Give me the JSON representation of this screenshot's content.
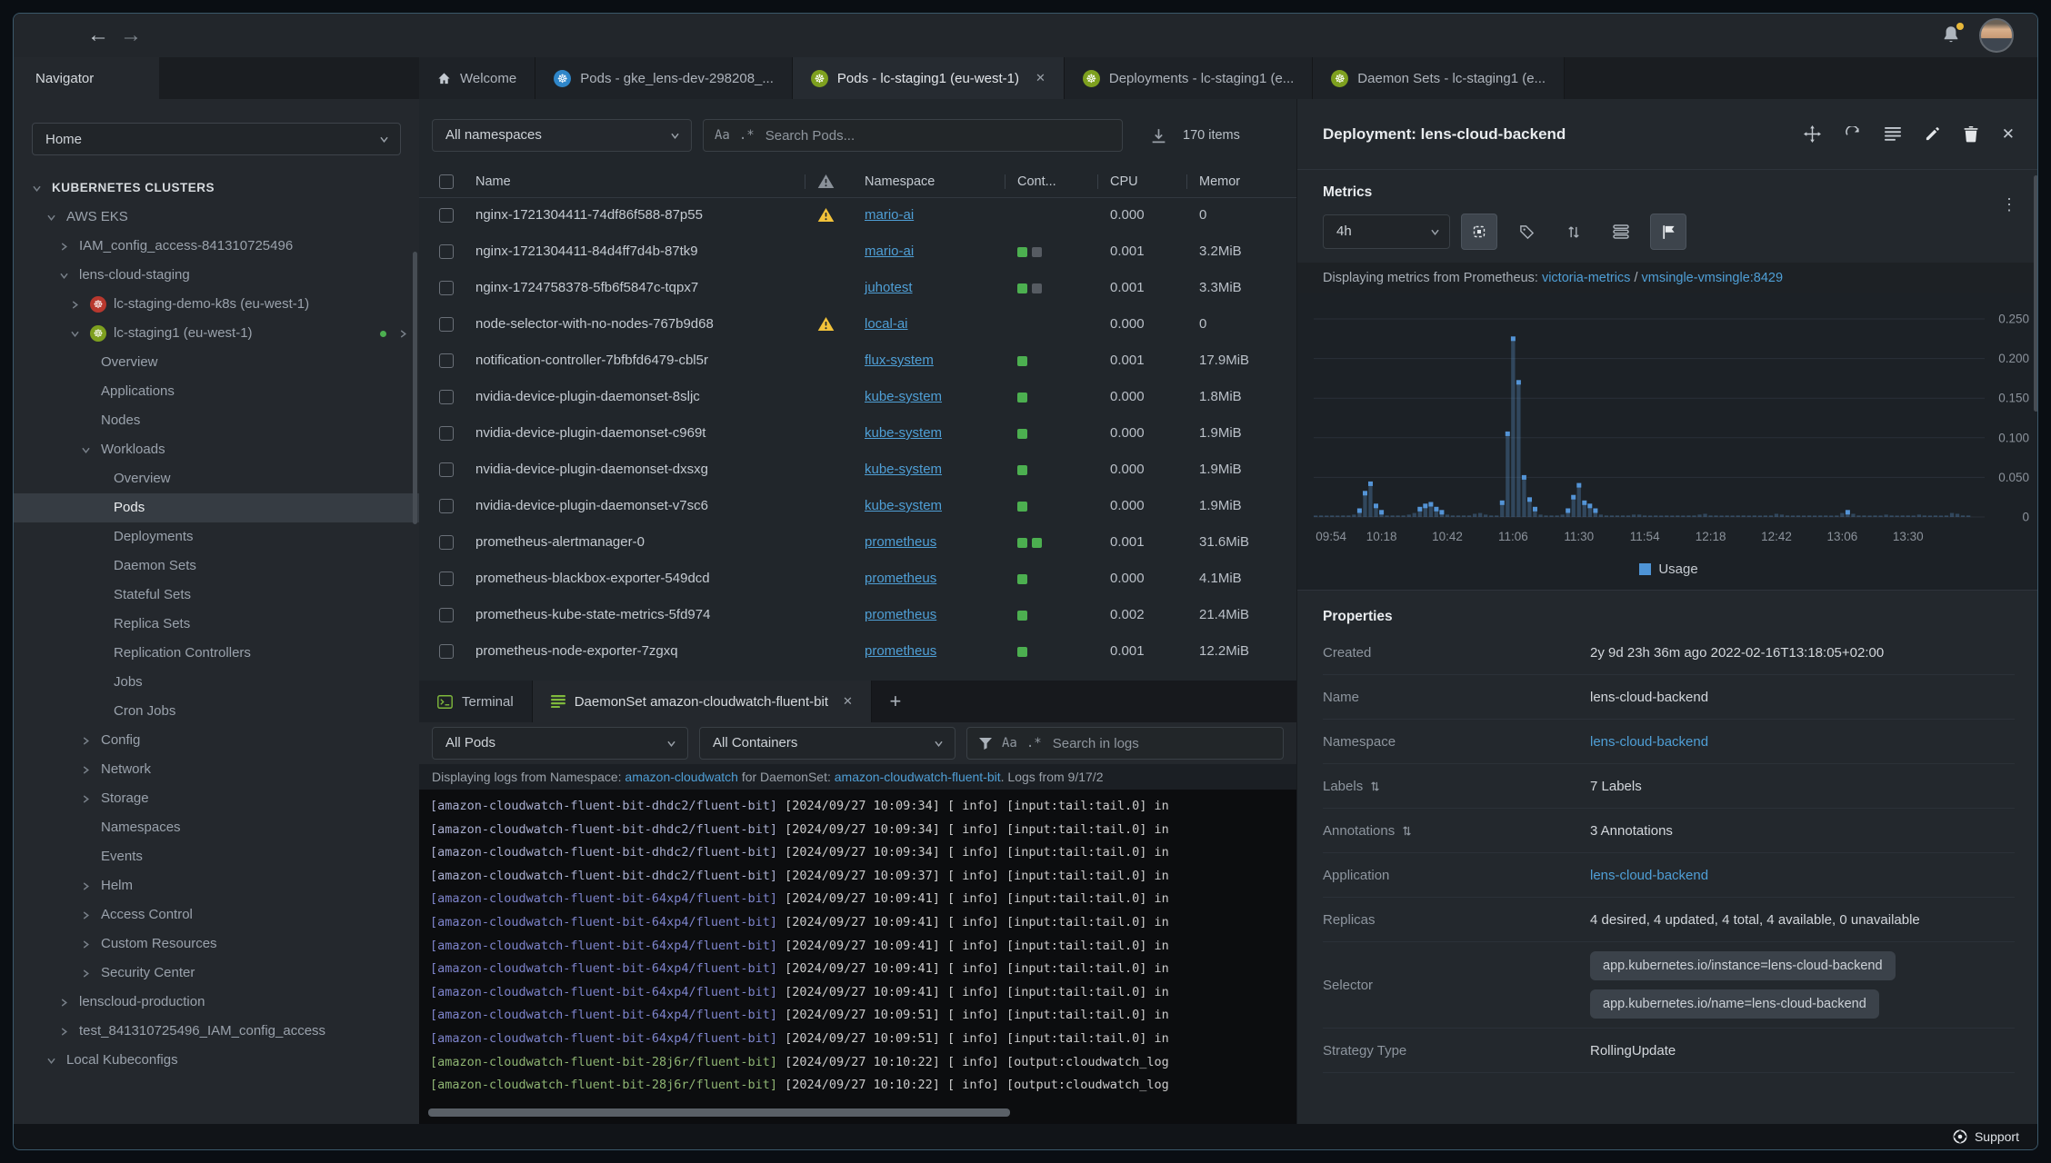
{
  "topbar": {
    "back": "←",
    "forward": "→"
  },
  "tabs": {
    "navigator": "Navigator",
    "items": [
      {
        "label": "Welcome",
        "icon": "home",
        "active": false,
        "close": false,
        "icon_color": ""
      },
      {
        "label": "Pods - gke_lens-dev-298208_...",
        "icon": "k8s",
        "icon_color": "#2f86c9",
        "active": false,
        "close": false
      },
      {
        "label": "Pods - lc-staging1 (eu-west-1)",
        "icon": "k8s",
        "icon_color": "#7ea01f",
        "active": true,
        "close": true
      },
      {
        "label": "Deployments - lc-staging1 (e...",
        "icon": "k8s",
        "icon_color": "#7ea01f",
        "active": false,
        "close": false
      },
      {
        "label": "Daemon Sets - lc-staging1 (e...",
        "icon": "k8s",
        "icon_color": "#7ea01f",
        "active": false,
        "close": false
      }
    ],
    "close_glyph": "✕"
  },
  "sidebar": {
    "selector": "Home",
    "tree": [
      {
        "label": "KUBERNETES CLUSTERS",
        "indent": 0,
        "caret": "down",
        "icon": "",
        "bold": true,
        "selected": false,
        "trailing": false
      },
      {
        "label": "AWS EKS",
        "indent": 1,
        "caret": "down",
        "icon": "",
        "bold": false,
        "selected": false,
        "trailing": false
      },
      {
        "label": "IAM_config_access-841310725496",
        "indent": 2,
        "caret": "right",
        "icon": "",
        "bold": false,
        "selected": false,
        "trailing": false
      },
      {
        "label": "lens-cloud-staging",
        "indent": 2,
        "caret": "down",
        "icon": "",
        "bold": false,
        "selected": false,
        "trailing": false
      },
      {
        "label": "lc-staging-demo-k8s (eu-west-1)",
        "indent": 3,
        "caret": "right",
        "icon": "red",
        "bold": false,
        "selected": false,
        "trailing": false
      },
      {
        "label": "lc-staging1 (eu-west-1)",
        "indent": 3,
        "caret": "down",
        "icon": "green",
        "bold": false,
        "selected": false,
        "trailing": true
      },
      {
        "label": "Overview",
        "indent": 4,
        "caret": "",
        "icon": "",
        "bold": false,
        "selected": false,
        "trailing": false
      },
      {
        "label": "Applications",
        "indent": 4,
        "caret": "",
        "icon": "",
        "bold": false,
        "selected": false,
        "trailing": false
      },
      {
        "label": "Nodes",
        "indent": 4,
        "caret": "",
        "icon": "",
        "bold": false,
        "selected": false,
        "trailing": false
      },
      {
        "label": "Workloads",
        "indent": 4,
        "caret": "down",
        "icon": "",
        "bold": false,
        "selected": false,
        "trailing": false
      },
      {
        "label": "Overview",
        "indent": 5,
        "caret": "",
        "icon": "",
        "bold": false,
        "selected": false,
        "trailing": false
      },
      {
        "label": "Pods",
        "indent": 5,
        "caret": "",
        "icon": "",
        "bold": false,
        "selected": true,
        "trailing": false
      },
      {
        "label": "Deployments",
        "indent": 5,
        "caret": "",
        "icon": "",
        "bold": false,
        "selected": false,
        "trailing": false
      },
      {
        "label": "Daemon Sets",
        "indent": 5,
        "caret": "",
        "icon": "",
        "bold": false,
        "selected": false,
        "trailing": false
      },
      {
        "label": "Stateful Sets",
        "indent": 5,
        "caret": "",
        "icon": "",
        "bold": false,
        "selected": false,
        "trailing": false
      },
      {
        "label": "Replica Sets",
        "indent": 5,
        "caret": "",
        "icon": "",
        "bold": false,
        "selected": false,
        "trailing": false
      },
      {
        "label": "Replication Controllers",
        "indent": 5,
        "caret": "",
        "icon": "",
        "bold": false,
        "selected": false,
        "trailing": false
      },
      {
        "label": "Jobs",
        "indent": 5,
        "caret": "",
        "icon": "",
        "bold": false,
        "selected": false,
        "trailing": false
      },
      {
        "label": "Cron Jobs",
        "indent": 5,
        "caret": "",
        "icon": "",
        "bold": false,
        "selected": false,
        "trailing": false
      },
      {
        "label": "Config",
        "indent": 4,
        "caret": "right",
        "icon": "",
        "bold": false,
        "selected": false,
        "trailing": false
      },
      {
        "label": "Network",
        "indent": 4,
        "caret": "right",
        "icon": "",
        "bold": false,
        "selected": false,
        "trailing": false
      },
      {
        "label": "Storage",
        "indent": 4,
        "caret": "right",
        "icon": "",
        "bold": false,
        "selected": false,
        "trailing": false
      },
      {
        "label": "Namespaces",
        "indent": 4,
        "caret": "",
        "icon": "",
        "bold": false,
        "selected": false,
        "trailing": false
      },
      {
        "label": "Events",
        "indent": 4,
        "caret": "",
        "icon": "",
        "bold": false,
        "selected": false,
        "trailing": false
      },
      {
        "label": "Helm",
        "indent": 4,
        "caret": "right",
        "icon": "",
        "bold": false,
        "selected": false,
        "trailing": false
      },
      {
        "label": "Access Control",
        "indent": 4,
        "caret": "right",
        "icon": "",
        "bold": false,
        "selected": false,
        "trailing": false
      },
      {
        "label": "Custom Resources",
        "indent": 4,
        "caret": "right",
        "icon": "",
        "bold": false,
        "selected": false,
        "trailing": false
      },
      {
        "label": "Security Center",
        "indent": 4,
        "caret": "right",
        "icon": "",
        "bold": false,
        "selected": false,
        "trailing": false
      },
      {
        "label": "lenscloud-production",
        "indent": 2,
        "caret": "right",
        "icon": "",
        "bold": false,
        "selected": false,
        "trailing": false
      },
      {
        "label": "test_841310725496_IAM_config_access",
        "indent": 2,
        "caret": "right",
        "icon": "",
        "bold": false,
        "selected": false,
        "trailing": false
      },
      {
        "label": "Local Kubeconfigs",
        "indent": 1,
        "caret": "down",
        "icon": "",
        "bold": false,
        "selected": false,
        "trailing": false
      }
    ]
  },
  "pods": {
    "namespace_filter": "All namespaces",
    "case_icon": "Aa",
    "regex_icon": ".*",
    "search_placeholder": "Search Pods...",
    "items_count": "170 items",
    "columns": [
      "Name",
      "Namespace",
      "Cont...",
      "CPU",
      "Memor"
    ],
    "rows": [
      {
        "name": "nginx-1721304411-74df86f588-87p55",
        "warning": true,
        "namespace": "mario-ai",
        "containers": [],
        "cpu": "0.000",
        "memory": "0"
      },
      {
        "name": "nginx-1721304411-84d4ff7d4b-87tk9",
        "warning": false,
        "namespace": "mario-ai",
        "containers": [
          "g",
          "x"
        ],
        "cpu": "0.001",
        "memory": "3.2MiB"
      },
      {
        "name": "nginx-1724758378-5fb6f5847c-tqpx7",
        "warning": false,
        "namespace": "juhotest",
        "containers": [
          "g",
          "x"
        ],
        "cpu": "0.001",
        "memory": "3.3MiB"
      },
      {
        "name": "node-selector-with-no-nodes-767b9d68",
        "warning": true,
        "namespace": "local-ai",
        "containers": [],
        "cpu": "0.000",
        "memory": "0"
      },
      {
        "name": "notification-controller-7bfbfd6479-cbl5r",
        "warning": false,
        "namespace": "flux-system",
        "containers": [
          "g"
        ],
        "cpu": "0.001",
        "memory": "17.9MiB"
      },
      {
        "name": "nvidia-device-plugin-daemonset-8sljc",
        "warning": false,
        "namespace": "kube-system",
        "containers": [
          "g"
        ],
        "cpu": "0.000",
        "memory": "1.8MiB"
      },
      {
        "name": "nvidia-device-plugin-daemonset-c969t",
        "warning": false,
        "namespace": "kube-system",
        "containers": [
          "g"
        ],
        "cpu": "0.000",
        "memory": "1.9MiB"
      },
      {
        "name": "nvidia-device-plugin-daemonset-dxsxg",
        "warning": false,
        "namespace": "kube-system",
        "containers": [
          "g"
        ],
        "cpu": "0.000",
        "memory": "1.9MiB"
      },
      {
        "name": "nvidia-device-plugin-daemonset-v7sc6",
        "warning": false,
        "namespace": "kube-system",
        "containers": [
          "g"
        ],
        "cpu": "0.000",
        "memory": "1.9MiB"
      },
      {
        "name": "prometheus-alertmanager-0",
        "warning": false,
        "namespace": "prometheus",
        "containers": [
          "g",
          "g"
        ],
        "cpu": "0.001",
        "memory": "31.6MiB"
      },
      {
        "name": "prometheus-blackbox-exporter-549dcd",
        "warning": false,
        "namespace": "prometheus",
        "containers": [
          "g"
        ],
        "cpu": "0.000",
        "memory": "4.1MiB"
      },
      {
        "name": "prometheus-kube-state-metrics-5fd974",
        "warning": false,
        "namespace": "prometheus",
        "containers": [
          "g"
        ],
        "cpu": "0.002",
        "memory": "21.4MiB"
      },
      {
        "name": "prometheus-node-exporter-7zgxq",
        "warning": false,
        "namespace": "prometheus",
        "containers": [
          "g"
        ],
        "cpu": "0.001",
        "memory": "12.2MiB"
      }
    ]
  },
  "dock": {
    "tabs": [
      {
        "label": "Terminal",
        "icon": "terminal",
        "active": false,
        "close": false
      },
      {
        "label": "DaemonSet amazon-cloudwatch-fluent-bit",
        "icon": "logs",
        "active": true,
        "close": true
      }
    ],
    "plus": "+",
    "pod_filter": "All Pods",
    "container_filter": "All Containers",
    "case_icon": "Aa",
    "regex_icon": ".*",
    "search_placeholder": "Search in logs",
    "info": {
      "prefix": "Displaying logs from Namespace: ",
      "ns_link": "amazon-cloudwatch",
      "middle": " for DaemonSet: ",
      "ds_link": "amazon-cloudwatch-fluent-bit",
      "suffix": ". Logs from 9/17/2"
    },
    "lines": [
      {
        "pod": "amazon-cloudwatch-fluent-bit-dhdc2/fluent-bit",
        "time": "2024/09/27 10:09:34",
        "rest": "[ info] [input:tail:tail.0] in",
        "color": "#a9aed0"
      },
      {
        "pod": "amazon-cloudwatch-fluent-bit-dhdc2/fluent-bit",
        "time": "2024/09/27 10:09:34",
        "rest": "[ info] [input:tail:tail.0] in",
        "color": "#a9aed0"
      },
      {
        "pod": "amazon-cloudwatch-fluent-bit-dhdc2/fluent-bit",
        "time": "2024/09/27 10:09:34",
        "rest": "[ info] [input:tail:tail.0] in",
        "color": "#a9aed0"
      },
      {
        "pod": "amazon-cloudwatch-fluent-bit-dhdc2/fluent-bit",
        "time": "2024/09/27 10:09:37",
        "rest": "[ info] [input:tail:tail.0] in",
        "color": "#a9aed0"
      },
      {
        "pod": "amazon-cloudwatch-fluent-bit-64xp4/fluent-bit",
        "time": "2024/09/27 10:09:41",
        "rest": "[ info] [input:tail:tail.0] in",
        "color": "#7e84cc"
      },
      {
        "pod": "amazon-cloudwatch-fluent-bit-64xp4/fluent-bit",
        "time": "2024/09/27 10:09:41",
        "rest": "[ info] [input:tail:tail.0] in",
        "color": "#7e84cc"
      },
      {
        "pod": "amazon-cloudwatch-fluent-bit-64xp4/fluent-bit",
        "time": "2024/09/27 10:09:41",
        "rest": "[ info] [input:tail:tail.0] in",
        "color": "#7e84cc"
      },
      {
        "pod": "amazon-cloudwatch-fluent-bit-64xp4/fluent-bit",
        "time": "2024/09/27 10:09:41",
        "rest": "[ info] [input:tail:tail.0] in",
        "color": "#7e84cc"
      },
      {
        "pod": "amazon-cloudwatch-fluent-bit-64xp4/fluent-bit",
        "time": "2024/09/27 10:09:41",
        "rest": "[ info] [input:tail:tail.0] in",
        "color": "#7e84cc"
      },
      {
        "pod": "amazon-cloudwatch-fluent-bit-64xp4/fluent-bit",
        "time": "2024/09/27 10:09:51",
        "rest": "[ info] [input:tail:tail.0] in",
        "color": "#7e84cc"
      },
      {
        "pod": "amazon-cloudwatch-fluent-bit-64xp4/fluent-bit",
        "time": "2024/09/27 10:09:51",
        "rest": "[ info] [input:tail:tail.0] in",
        "color": "#7e84cc"
      },
      {
        "pod": "amazon-cloudwatch-fluent-bit-28j6r/fluent-bit",
        "time": "2024/09/27 10:10:22",
        "rest": "[ info] [output:cloudwatch_log",
        "color": "#8fb573"
      },
      {
        "pod": "amazon-cloudwatch-fluent-bit-28j6r/fluent-bit",
        "time": "2024/09/27 10:10:22",
        "rest": "[ info] [output:cloudwatch_log",
        "color": "#8fb573"
      }
    ]
  },
  "drawer": {
    "title": "Deployment: lens-cloud-backend",
    "metrics_title": "Metrics",
    "menu_dots": "⋮",
    "range": "4h",
    "prom_prefix": "Displaying metrics from Prometheus: ",
    "prom_link1": "victoria-metrics",
    "prom_sep": " / ",
    "prom_link2": "vmsingle-vmsingle:8429",
    "legend": "Usage",
    "properties_title": "Properties",
    "properties": [
      {
        "label": "Created",
        "value": "2y 9d 23h 36m ago 2022-02-16T13:18:05+02:00",
        "link": false,
        "sortable": false
      },
      {
        "label": "Name",
        "value": "lens-cloud-backend",
        "link": false,
        "sortable": false
      },
      {
        "label": "Namespace",
        "value": "lens-cloud-backend",
        "link": true,
        "sortable": false
      },
      {
        "label": "Labels",
        "value": "7 Labels",
        "link": false,
        "sortable": true
      },
      {
        "label": "Annotations",
        "value": "3 Annotations",
        "link": false,
        "sortable": true
      },
      {
        "label": "Application",
        "value": "lens-cloud-backend",
        "link": true,
        "sortable": false
      },
      {
        "label": "Replicas",
        "value": "4 desired, 4 updated, 4 total, 4 available, 0 unavailable",
        "link": false,
        "sortable": false
      },
      {
        "label": "Selector",
        "chips": [
          "app.kubernetes.io/instance=lens-cloud-backend",
          "app.kubernetes.io/name=lens-cloud-backend"
        ],
        "link": false,
        "sortable": false
      },
      {
        "label": "Strategy Type",
        "value": "RollingUpdate",
        "link": false,
        "sortable": false
      }
    ],
    "support": "Support"
  },
  "colors": {
    "accent_link": "#4f9fd6",
    "container_green": "#4caf50",
    "container_gray": "#565b62",
    "warning_yellow": "#f2c23a",
    "chart_bar": "rgba(88,142,197,0.35)",
    "chart_marker": "#5494d6",
    "cluster_red": "#b8382e",
    "cluster_green": "#7ea01f"
  },
  "chart_data": {
    "type": "bar",
    "title": "Deployment pod CPU usage (cores)",
    "x_start": "09:54",
    "step_minutes": 2,
    "values": [
      0.001,
      0.002,
      0.001,
      0.002,
      0.001,
      0.002,
      0.002,
      0.003,
      0.008,
      0.03,
      0.042,
      0.014,
      0.006,
      0.002,
      0.002,
      0.002,
      0.002,
      0.003,
      0.005,
      0.01,
      0.014,
      0.016,
      0.01,
      0.006,
      0.003,
      0.002,
      0.002,
      0.002,
      0.002,
      0.004,
      0.005,
      0.003,
      0.002,
      0.002,
      0.018,
      0.105,
      0.225,
      0.17,
      0.05,
      0.022,
      0.01,
      0.003,
      0.002,
      0.002,
      0.002,
      0.003,
      0.008,
      0.025,
      0.04,
      0.018,
      0.014,
      0.008,
      0.003,
      0.002,
      0.002,
      0.002,
      0.002,
      0.002,
      0.003,
      0.003,
      0.002,
      0.001,
      0.002,
      0.001,
      0.002,
      0.001,
      0.002,
      0.001,
      0.002,
      0.002,
      0.003,
      0.004,
      0.002,
      0.002,
      0.001,
      0.002,
      0.001,
      0.002,
      0.002,
      0.001,
      0.002,
      0.001,
      0.002,
      0.002,
      0.004,
      0.003,
      0.002,
      0.001,
      0.002,
      0.001,
      0.002,
      0.001,
      0.002,
      0.002,
      0.001,
      0.002,
      0.005,
      0.006,
      0.004,
      0.002,
      0.002,
      0.001,
      0.002,
      0.001,
      0.003,
      0.002,
      0.001,
      0.002,
      0.002,
      0.001,
      0.003,
      0.002,
      0.001,
      0.002,
      0.001,
      0.002,
      0.005,
      0.004,
      0.002,
      0.002
    ],
    "xtick_labels": [
      "09:54",
      "10:18",
      "10:42",
      "11:06",
      "11:30",
      "11:54",
      "12:18",
      "12:42",
      "13:06",
      "13:30"
    ],
    "xtick_indices": [
      0,
      12,
      24,
      36,
      48,
      60,
      72,
      84,
      96,
      108
    ],
    "ytick_values": [
      0,
      0.05,
      0.1,
      0.15,
      0.2,
      0.25
    ],
    "ytick_labels": [
      "0",
      "0.050",
      "0.100",
      "0.150",
      "0.200",
      "0.250"
    ],
    "ylim": [
      0,
      0.25
    ],
    "grid": true,
    "legend_entries": [
      "Usage"
    ],
    "legend_position": "bottom"
  }
}
